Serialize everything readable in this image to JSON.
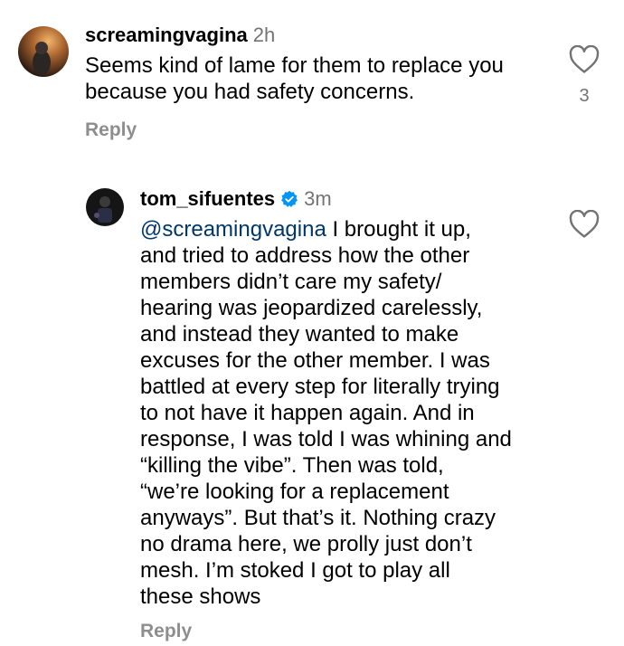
{
  "comments": [
    {
      "username": "screamingvagina",
      "time": "2h",
      "lines": [
        "Seems kind of lame for them to replace you",
        "because you had safety concerns."
      ],
      "reply_label": "Reply",
      "like_count": "3"
    },
    {
      "username": "tom_sifuentes",
      "verified": true,
      "time": "3m",
      "mention": "@screamingvagina",
      "first_line_rest": " I brought it up,",
      "lines": [
        "and tried to address how the other",
        "members didn’t care my safety/",
        "hearing was jeopardized carelessly,",
        "and instead they wanted to make",
        "excuses for the other member. I was",
        "battled at every step for literally trying",
        "to not have it happen again. And in",
        "response, I was told I was whining and",
        "“killing the vibe”. Then was told,",
        "“we’re looking for a replacement",
        "anyways”. But that’s it. Nothing crazy",
        "no drama here, we prolly just don’t",
        "mesh. I’m stoked I got to play all",
        "these shows"
      ],
      "reply_label": "Reply"
    }
  ],
  "colors": {
    "text": "#000000",
    "secondary": "#737373",
    "mention": "#00376b",
    "verified": "#0095f6"
  },
  "icons": {
    "like": "heart-outline-icon",
    "verified": "verified-badge-icon"
  }
}
